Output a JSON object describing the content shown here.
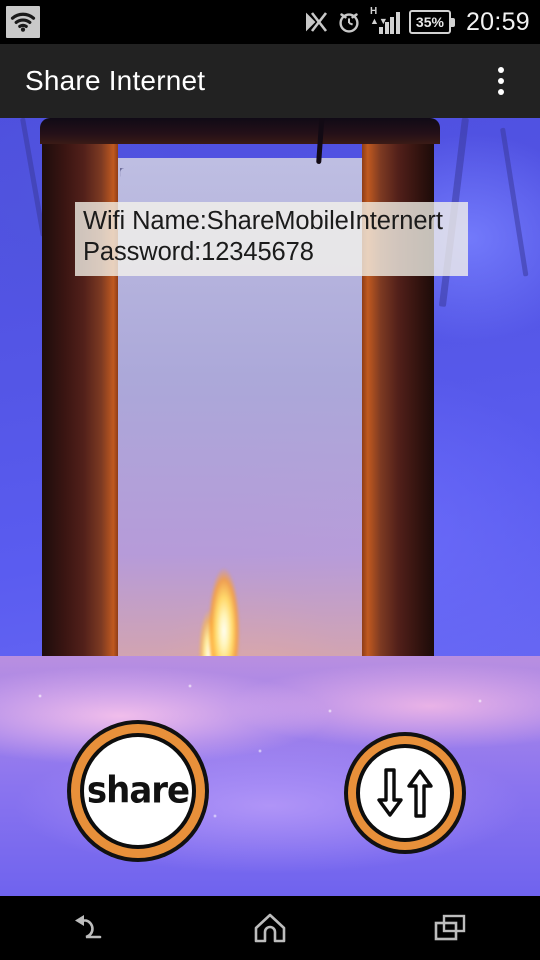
{
  "status_bar": {
    "wifi_hotspot_icon": "wifi-icon",
    "vibrate_icon": "vibrate-mute-icon",
    "alarm_icon": "alarm-clock-icon",
    "network_type": "H",
    "signal_icon": "signal-bars-icon",
    "battery_percent": "35%",
    "time": "20:59"
  },
  "action_bar": {
    "title": "Share Internet",
    "overflow_icon": "overflow-menu-icon"
  },
  "main": {
    "wifi_name_line": "Wifi Name:ShareMobileInternert",
    "password_line": "Password:12345678",
    "share_button_label": "share",
    "data_toggle_icon": "data-transfer-arrows-icon"
  },
  "nav_bar": {
    "back_icon": "back-arrow-icon",
    "home_icon": "home-icon",
    "recents_icon": "recent-apps-icon"
  },
  "colors": {
    "accent_orange": "#e8903a",
    "action_bar_bg": "#222222",
    "status_bar_bg": "#000000",
    "info_box_bg": "rgba(245,243,235,0.78)",
    "sky_blue": "#5456e6",
    "snow_purple": "#a584ea"
  }
}
